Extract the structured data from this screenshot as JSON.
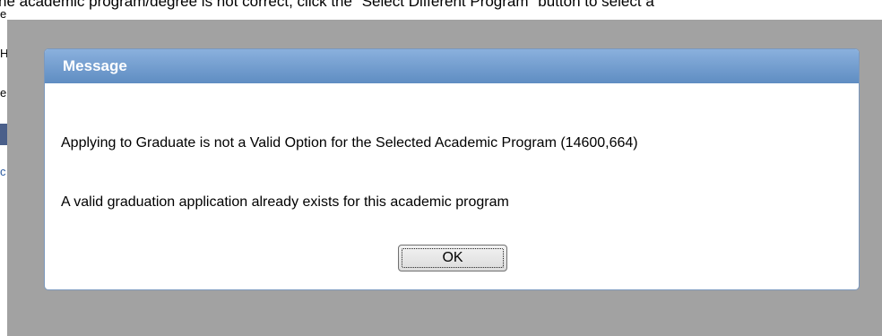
{
  "background": {
    "top_line": "he academic program/degree is not correct, click the \"Select Different Program\" button to select a",
    "fragments": [
      "e",
      "H",
      "e",
      "c"
    ]
  },
  "dialog": {
    "title": "Message",
    "message_1": "Applying to Graduate is not a Valid Option for the Selected Academic Program (14600,664)",
    "message_2": "A valid graduation application already exists for this academic program",
    "ok_label": "OK"
  },
  "colors": {
    "overlay": "#a2a2a2",
    "header": "#6f9bd0",
    "border": "#7b98bd"
  }
}
